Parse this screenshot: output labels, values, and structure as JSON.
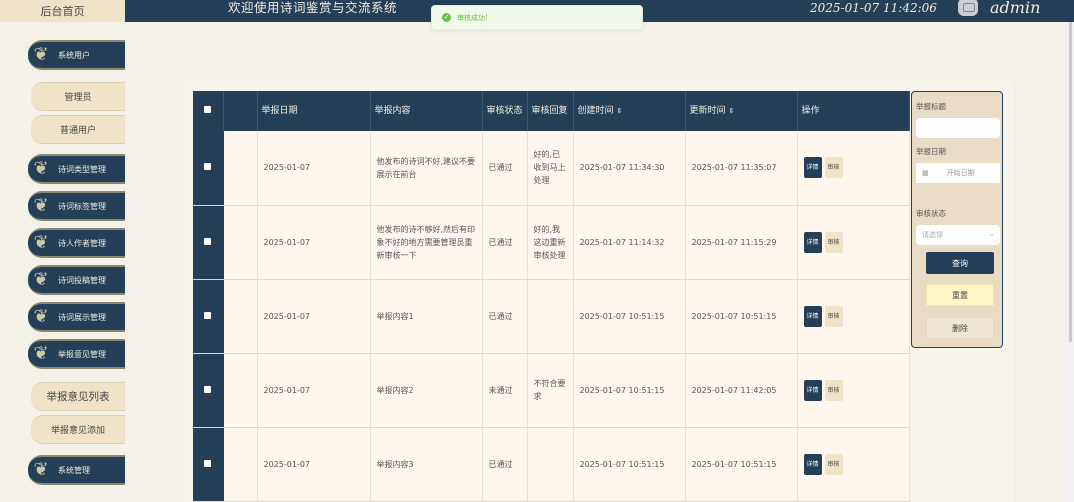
{
  "header": {
    "home_label": "后台首页",
    "app_title": "欢迎使用诗词鉴赏与交流系统",
    "datetime": "2025-01-07 11:42:06",
    "username": "admin"
  },
  "toast": {
    "icon": "check-circle-icon",
    "text": "审核成功!",
    "color": "#67c23a"
  },
  "sidebar": {
    "items": [
      {
        "label": "系统用户",
        "type": "menu"
      },
      {
        "label": "管理员",
        "type": "sub"
      },
      {
        "label": "普通用户",
        "type": "sub"
      },
      {
        "label": "诗词类型管理",
        "type": "menu"
      },
      {
        "label": "诗词标签管理",
        "type": "menu"
      },
      {
        "label": "诗人作者管理",
        "type": "menu"
      },
      {
        "label": "诗词投稿管理",
        "type": "menu"
      },
      {
        "label": "诗词展示管理",
        "type": "menu"
      },
      {
        "label": "举报意见管理",
        "type": "menu"
      },
      {
        "label": "举报意见列表",
        "type": "sub"
      },
      {
        "label": "举报意见添加",
        "type": "sub"
      },
      {
        "label": "系统管理",
        "type": "menu"
      }
    ]
  },
  "table": {
    "columns": [
      "举报日期",
      "举报内容",
      "审核状态",
      "审核回复",
      "创建时间",
      "更新时间",
      "操作"
    ],
    "detail_label": "详情",
    "review_label": "审核",
    "rows": [
      {
        "date": "2025-01-07",
        "content": "他发布的诗词不好,建议不要展示在前台",
        "status": "已通过",
        "reply": "好的,已收到马上处理",
        "created": "2025-01-07 11:34:30",
        "updated": "2025-01-07 11:35:07"
      },
      {
        "date": "2025-01-07",
        "content": "他发布的诗不够好,然后有印象不好的地方需要管理员重新审核一下",
        "status": "已通过",
        "reply": "好的,我这边重新审核处理",
        "created": "2025-01-07 11:14:32",
        "updated": "2025-01-07 11:15:29"
      },
      {
        "date": "2025-01-07",
        "content": "举报内容1",
        "status": "已通过",
        "reply": "",
        "created": "2025-01-07 10:51:15",
        "updated": "2025-01-07 10:51:15"
      },
      {
        "date": "2025-01-07",
        "content": "举报内容2",
        "status": "未通过",
        "reply": "不符合要求",
        "created": "2025-01-07 10:51:15",
        "updated": "2025-01-07 11:42:05"
      },
      {
        "date": "2025-01-07",
        "content": "举报内容3",
        "status": "已通过",
        "reply": "",
        "created": "2025-01-07 10:51:15",
        "updated": "2025-01-07 10:51:15"
      }
    ]
  },
  "search": {
    "title_label": "举报标题",
    "title_value": "",
    "date_label": "举报日期",
    "date_placeholder": "开始日期",
    "status_label": "审核状态",
    "status_placeholder": "请选择",
    "query_label": "查询",
    "reset_label": "重置",
    "delete_label": "删除"
  },
  "colors": {
    "primary": "#234058",
    "cream": "#efe4c8",
    "row_bg": "#fff6ee"
  }
}
